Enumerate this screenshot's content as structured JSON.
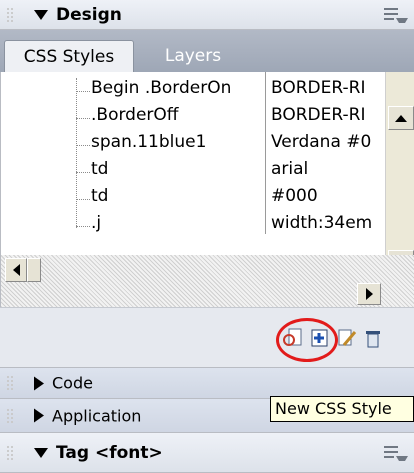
{
  "design_panel": {
    "title": "Design",
    "menu_icon": "panel-menu-icon"
  },
  "tabs": [
    {
      "label": "CSS Styles"
    },
    {
      "label": "Layers"
    }
  ],
  "styles": [
    {
      "name": "Begin .BorderOn",
      "value": "BORDER-RI"
    },
    {
      "name": ".BorderOff",
      "value": "BORDER-RI"
    },
    {
      "name": "span.11blue1",
      "value": "Verdana #0"
    },
    {
      "name": "td",
      "value": "arial"
    },
    {
      "name": "td",
      "value": "#000"
    },
    {
      "name": ".j",
      "value": "width:34em"
    }
  ],
  "toolbar": {
    "icons": [
      "attach-style-sheet-icon",
      "new-css-style-icon",
      "edit-style-icon",
      "delete-style-icon"
    ],
    "highlighted": "new-css-style-icon"
  },
  "code_panel": {
    "title": "Code"
  },
  "application_panel": {
    "title": "Application"
  },
  "tag_panel": {
    "title": "Tag <font>"
  },
  "tooltip": {
    "text": "New CSS Style"
  },
  "colors": {
    "annotation_circle": "#e21b1b",
    "tab_bar": "#a7afbd",
    "panel_header": "#e3e7ee"
  }
}
